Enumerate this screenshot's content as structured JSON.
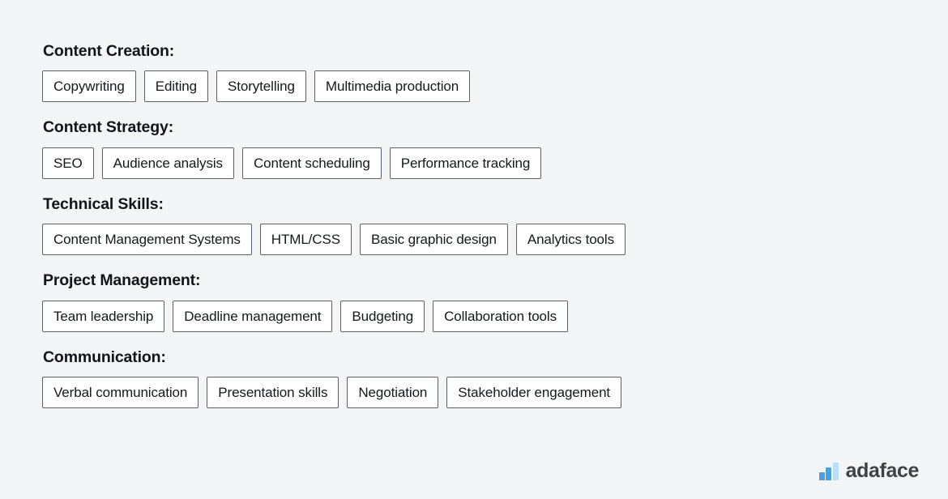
{
  "background_color": "#f4f5f7",
  "chip": {
    "background": "#ffffff",
    "border_color": "#5b6068",
    "text_color": "#14181d"
  },
  "heading_color": "#111418",
  "sections": [
    {
      "heading": "Content Creation:",
      "chips": [
        "Copywriting",
        "Editing",
        "Storytelling",
        "Multimedia production"
      ]
    },
    {
      "heading": "Content Strategy:",
      "chips": [
        "SEO",
        "Audience analysis",
        "Content scheduling",
        "Performance tracking"
      ]
    },
    {
      "heading": "Technical Skills:",
      "chips": [
        "Content Management Systems",
        "HTML/CSS",
        "Basic graphic design",
        "Analytics tools"
      ]
    },
    {
      "heading": "Project Management:",
      "chips": [
        "Team leadership",
        "Deadline management",
        "Budgeting",
        "Collaboration tools"
      ]
    },
    {
      "heading": "Communication:",
      "chips": [
        "Verbal communication",
        "Presentation skills",
        "Negotiation",
        "Stakeholder engagement"
      ]
    }
  ],
  "brand": {
    "name": "adaface",
    "name_color": "#3f4245",
    "logo_icon": "bar-chart-icon",
    "bars": [
      {
        "color": "#4d9fe0"
      },
      {
        "color": "#3ba7ec"
      },
      {
        "color": "#badff6"
      }
    ]
  }
}
